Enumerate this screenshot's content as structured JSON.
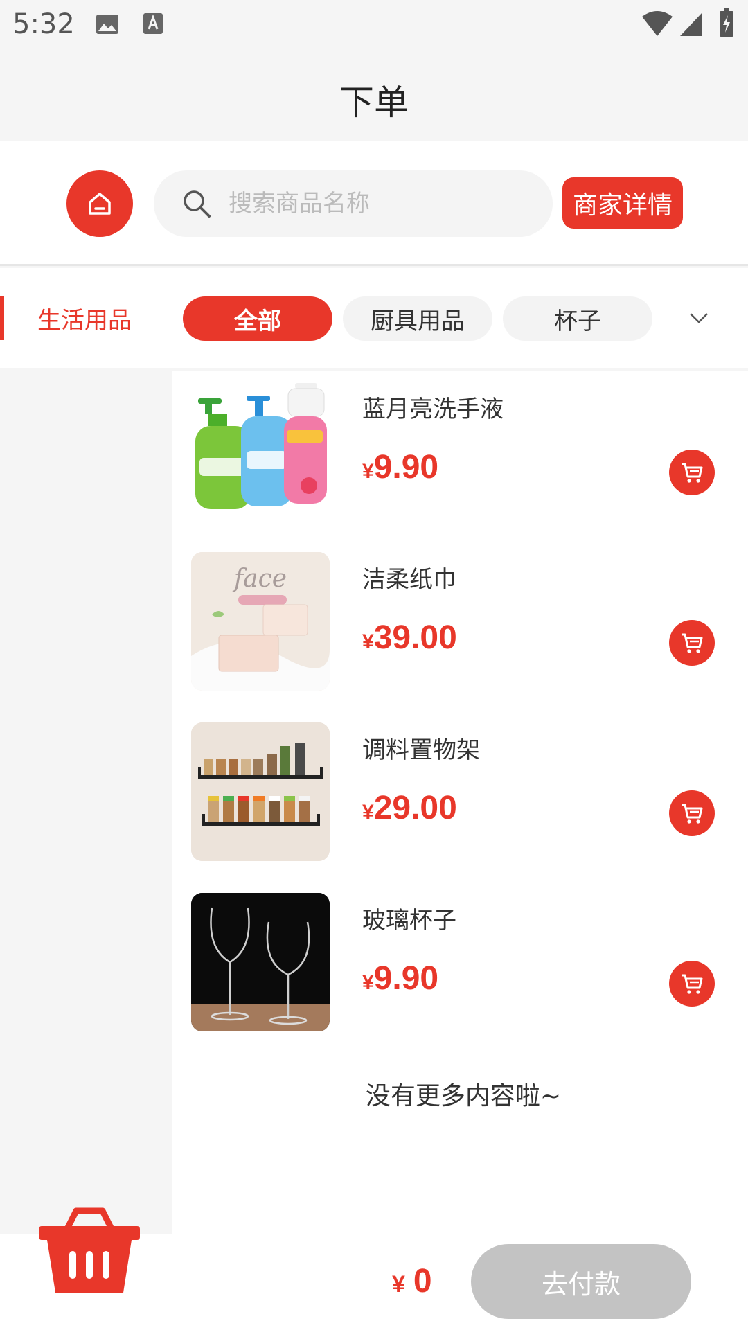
{
  "status_bar": {
    "time": "5:32"
  },
  "header": {
    "title": "下单"
  },
  "search": {
    "placeholder": "搜索商品名称",
    "merchant_button": "商家详情"
  },
  "categories": {
    "side_label": "生活用品",
    "chips": [
      "全部",
      "厨具用品",
      "杯子"
    ],
    "active_index": 0
  },
  "products": [
    {
      "name": "蓝月亮洗手液",
      "currency": "¥",
      "price": "9.90",
      "image": "hand-soap-bottles"
    },
    {
      "name": "洁柔纸巾",
      "currency": "¥",
      "price": "39.00",
      "image": "tissue-packs"
    },
    {
      "name": "调料置物架",
      "currency": "¥",
      "price": "29.00",
      "image": "spice-rack"
    },
    {
      "name": "玻璃杯子",
      "currency": "¥",
      "price": "9.90",
      "image": "wine-glasses"
    }
  ],
  "list_footer": "没有更多内容啦~",
  "cart": {
    "currency": "¥",
    "total": "0",
    "pay_label": "去付款"
  },
  "colors": {
    "accent": "#e8372a",
    "disabled": "#c3c3c3",
    "background": "#f5f5f5"
  }
}
